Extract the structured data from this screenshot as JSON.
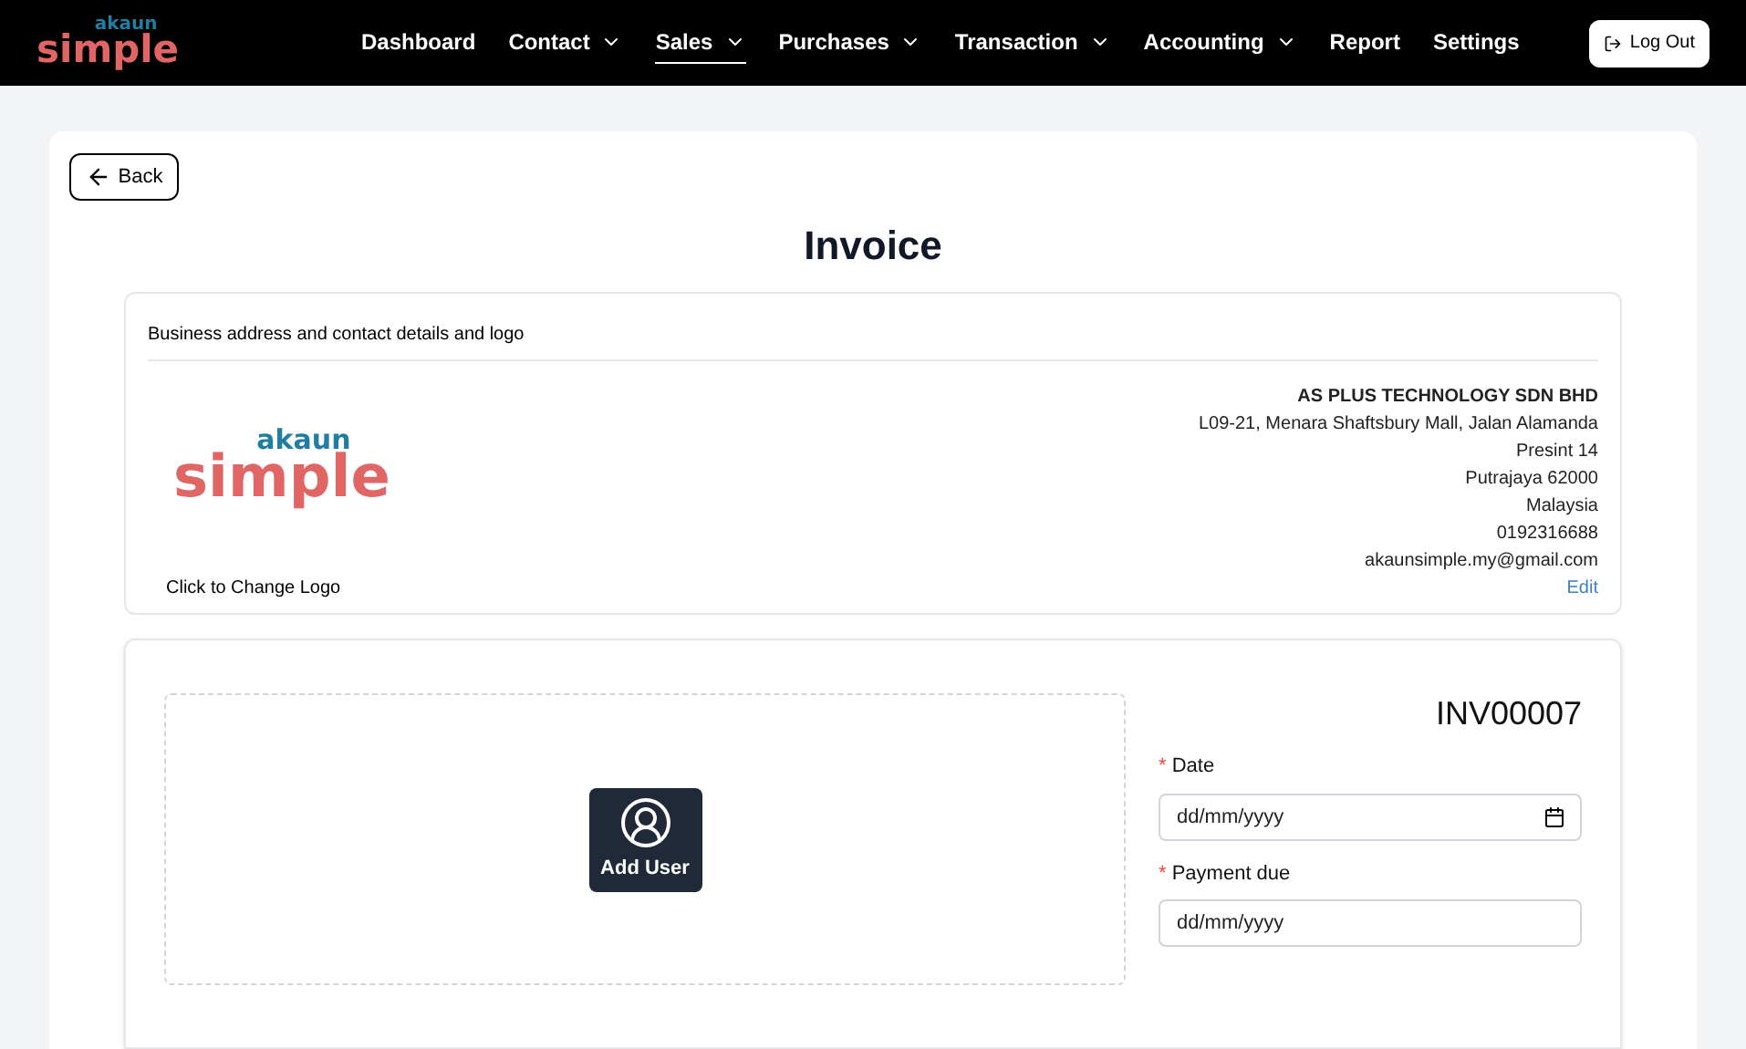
{
  "logo": {
    "top": "akaun",
    "bottom": "simple"
  },
  "business_logo": {
    "top": "akaun",
    "bottom": "simple"
  },
  "nav": [
    {
      "label": "Dashboard",
      "dropdown": false,
      "selected": false
    },
    {
      "label": "Contact",
      "dropdown": true,
      "selected": false
    },
    {
      "label": "Sales",
      "dropdown": true,
      "selected": true
    },
    {
      "label": "Purchases",
      "dropdown": true,
      "selected": false
    },
    {
      "label": "Transaction",
      "dropdown": true,
      "selected": false
    },
    {
      "label": "Accounting",
      "dropdown": true,
      "selected": false
    },
    {
      "label": "Report",
      "dropdown": false,
      "selected": false
    },
    {
      "label": "Settings",
      "dropdown": false,
      "selected": false
    }
  ],
  "logout": "Log Out",
  "back": "Back",
  "title": "Invoice",
  "business": {
    "heading": "Business address and contact details and logo",
    "change_logo": "Click to Change Logo",
    "company": "AS PLUS TECHNOLOGY SDN BHD",
    "lines": [
      "L09-21, Menara Shaftsbury Mall, Jalan Alamanda",
      "Presint 14",
      "Putrajaya 62000",
      "Malaysia",
      "0192316688",
      "akaunsimple.my@gmail.com"
    ],
    "edit": "Edit"
  },
  "customer": {
    "add_user": "Add User"
  },
  "invoice_number": "INV00007",
  "fields": [
    {
      "label": "Date",
      "required_mark": "*",
      "placeholder": "dd/mm/yyyy",
      "kind": "date"
    },
    {
      "label": "Payment due",
      "required_mark": "*",
      "placeholder": "dd/mm/yyyy",
      "kind": "text"
    }
  ]
}
